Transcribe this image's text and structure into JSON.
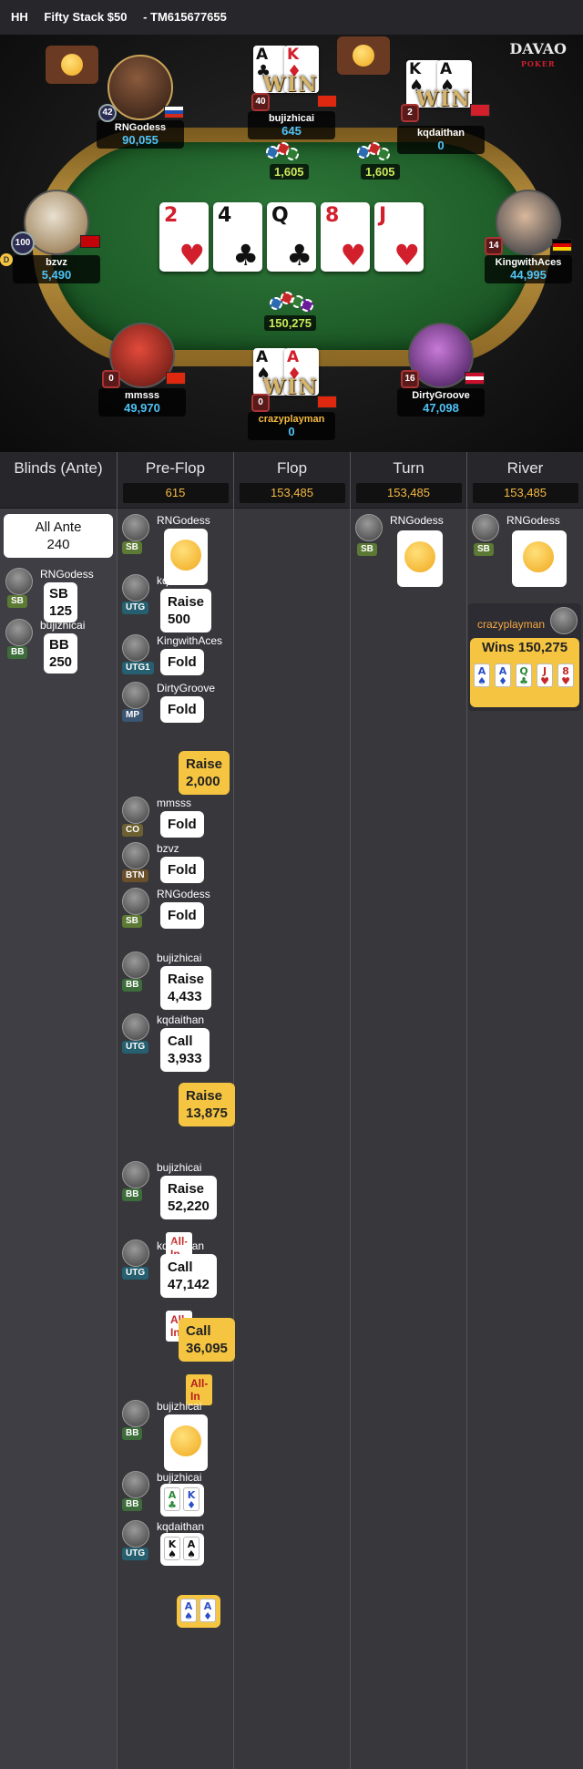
{
  "header": {
    "type": "HH",
    "title": "Fifty Stack $50",
    "hand_id": "- TM615677655"
  },
  "logo": {
    "name": "DAVAO",
    "sub": "POKER"
  },
  "board": [
    {
      "rank": "2",
      "suit": "♥",
      "color": "red"
    },
    {
      "rank": "4",
      "suit": "♣",
      "color": "black"
    },
    {
      "rank": "Q",
      "suit": "♣",
      "color": "black"
    },
    {
      "rank": "8",
      "suit": "♥",
      "color": "red"
    },
    {
      "rank": "J",
      "suit": "♥",
      "color": "red"
    }
  ],
  "pot": "150,275",
  "bets": {
    "left": "1,605",
    "right": "1,605"
  },
  "win_text": "WIN",
  "seats": [
    {
      "name": "RNGodess",
      "stack": "90,055",
      "level": "42"
    },
    {
      "name": "bujizhicai",
      "stack": "645",
      "level": "40"
    },
    {
      "name": "kqdaithan",
      "stack": "0",
      "level": "2"
    },
    {
      "name": "bzvz",
      "stack": "5,490",
      "level": "100"
    },
    {
      "name": "KingwithAces",
      "stack": "44,995",
      "level": "14"
    },
    {
      "name": "mmsss",
      "stack": "49,970",
      "level": "0"
    },
    {
      "name": "crazyplayman",
      "stack": "0",
      "level": "0"
    },
    {
      "name": "DirtyGroove",
      "stack": "47,098",
      "level": "16"
    }
  ],
  "hole_cards": {
    "bujizhicai": [
      {
        "rank": "A",
        "suit": "♣",
        "color": "black"
      },
      {
        "rank": "K",
        "suit": "♦",
        "color": "red"
      }
    ],
    "kqdaithan": [
      {
        "rank": "K",
        "suit": "♠",
        "color": "black"
      },
      {
        "rank": "A",
        "suit": "♠",
        "color": "black"
      }
    ],
    "crazyplayman": [
      {
        "rank": "A",
        "suit": "♠",
        "color": "black"
      },
      {
        "rank": "A",
        "suit": "♦",
        "color": "red"
      }
    ]
  },
  "dealer": "D",
  "columns": [
    {
      "title": "Blinds (Ante)",
      "pot": ""
    },
    {
      "title": "Pre-Flop",
      "pot": "615"
    },
    {
      "title": "Flop",
      "pot": "153,485"
    },
    {
      "title": "Turn",
      "pot": "153,485"
    },
    {
      "title": "River",
      "pot": "153,485"
    }
  ],
  "blinds": {
    "ante_label": "All Ante",
    "ante_value": "240",
    "sb": {
      "name": "RNGodess",
      "pos": "SB",
      "text": "SB  125"
    },
    "bb": {
      "name": "bujizhicai",
      "pos": "BB",
      "text": "BB  250"
    }
  },
  "preflop": [
    {
      "name": "RNGodess",
      "pos": "SB",
      "type": "emoji"
    },
    {
      "name": "kqdaithan",
      "pos": "UTG",
      "line1": "Raise",
      "line2": "500"
    },
    {
      "name": "KingwithAces",
      "pos": "UTG1",
      "line1": "Fold"
    },
    {
      "name": "DirtyGroove",
      "pos": "MP",
      "line1": "Fold"
    },
    {
      "hero": true,
      "line1": "Raise",
      "line2": "2,000"
    },
    {
      "name": "mmsss",
      "pos": "CO",
      "line1": "Fold"
    },
    {
      "name": "bzvz",
      "pos": "BTN",
      "line1": "Fold"
    },
    {
      "name": "RNGodess",
      "pos": "SB",
      "line1": "Fold"
    },
    {
      "name": "bujizhicai",
      "pos": "BB",
      "line1": "Raise",
      "line2": "4,433"
    },
    {
      "name": "kqdaithan",
      "pos": "UTG",
      "line1": "Call",
      "line2": "3,933"
    },
    {
      "hero": true,
      "line1": "Raise",
      "line2": "13,875"
    },
    {
      "name": "bujizhicai",
      "pos": "BB",
      "line1": "Raise",
      "line2": "52,220",
      "allin": "All-In"
    },
    {
      "name": "kqdaithan",
      "pos": "UTG",
      "line1": "Call",
      "line2": "47,142",
      "allin": "All-In"
    },
    {
      "hero": true,
      "line1": "Call",
      "line2": "36,095",
      "allin": "All-In"
    },
    {
      "name": "bujizhicai",
      "pos": "BB",
      "type": "emoji"
    },
    {
      "name": "bujizhicai",
      "pos": "BB",
      "type": "cards",
      "cards": [
        {
          "rank": "A",
          "suit": "♣",
          "color": "#2e8b3a"
        },
        {
          "rank": "K",
          "suit": "♦",
          "color": "#2b4fc9"
        }
      ]
    },
    {
      "name": "kqdaithan",
      "pos": "UTG",
      "type": "cards",
      "cards": [
        {
          "rank": "K",
          "suit": "♠",
          "color": "#111"
        },
        {
          "rank": "A",
          "suit": "♠",
          "color": "#111"
        }
      ]
    },
    {
      "hero": true,
      "type": "cards",
      "cards": [
        {
          "rank": "A",
          "suit": "♠",
          "color": "#2b4fc9"
        },
        {
          "rank": "A",
          "suit": "♦",
          "color": "#2b4fc9"
        }
      ]
    }
  ],
  "turn": {
    "name": "RNGodess",
    "pos": "SB"
  },
  "river": {
    "name": "RNGodess",
    "pos": "SB"
  },
  "winner": {
    "name": "crazyplayman",
    "label": "Wins 150,275",
    "cards": [
      {
        "rank": "A",
        "suit": "♠",
        "color": "#2b4fc9"
      },
      {
        "rank": "A",
        "suit": "♦",
        "color": "#2b4fc9"
      },
      {
        "rank": "Q",
        "suit": "♣",
        "color": "#2e8b3a"
      },
      {
        "rank": "J",
        "suit": "♥",
        "color": "#c62828"
      },
      {
        "rank": "8",
        "suit": "♥",
        "color": "#c62828"
      }
    ]
  }
}
